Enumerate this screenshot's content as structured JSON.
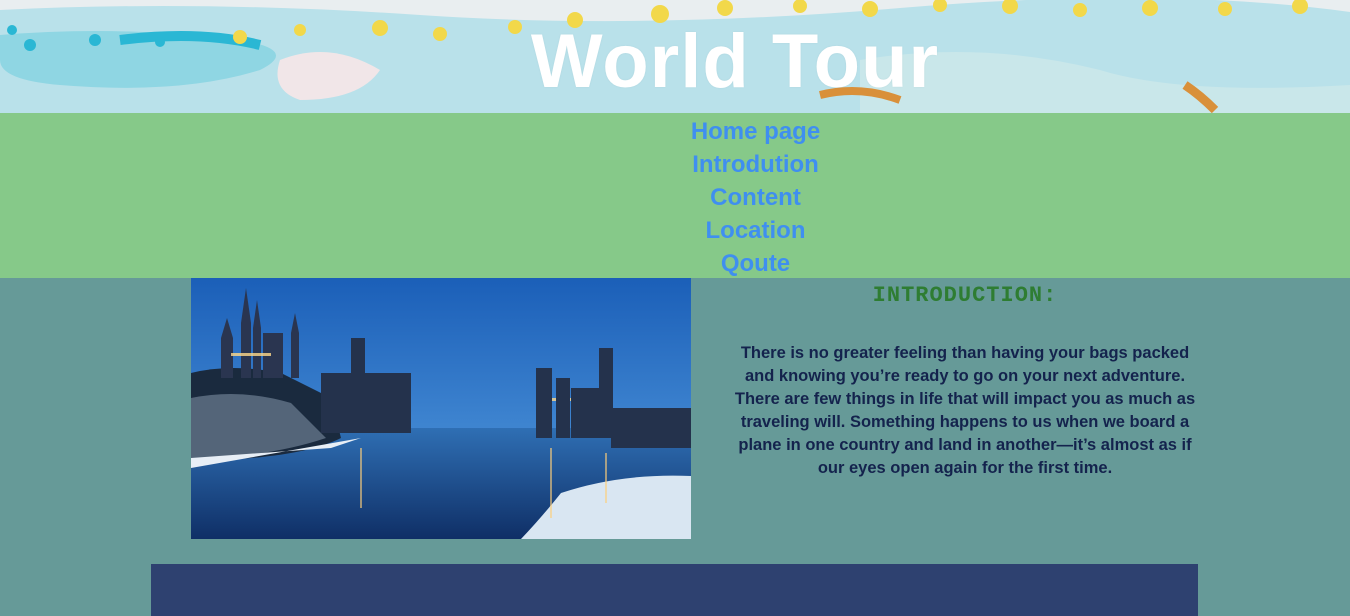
{
  "header": {
    "title": "World Tour"
  },
  "nav": {
    "items": [
      {
        "label": "Home page"
      },
      {
        "label": "Introdution"
      },
      {
        "label": "Content"
      },
      {
        "label": "Location"
      },
      {
        "label": "Qoute"
      }
    ],
    "link_color": "#3f8ff0",
    "background": "#86c989"
  },
  "intro": {
    "heading": "INTRODUCTION:",
    "text": "There is no greater feeling than having your bags packed and knowing you’re ready to go on your next adventure. There are few things in life that will impact you as much as traveling will. Something happens to us when we board a plane in one country and land in another—it’s almost as if our eyes open again for the first time."
  },
  "colors": {
    "page_background": "#669a98",
    "footer_band": "#2e4170",
    "heading": "#2e7d32",
    "body_text": "#14234d"
  }
}
